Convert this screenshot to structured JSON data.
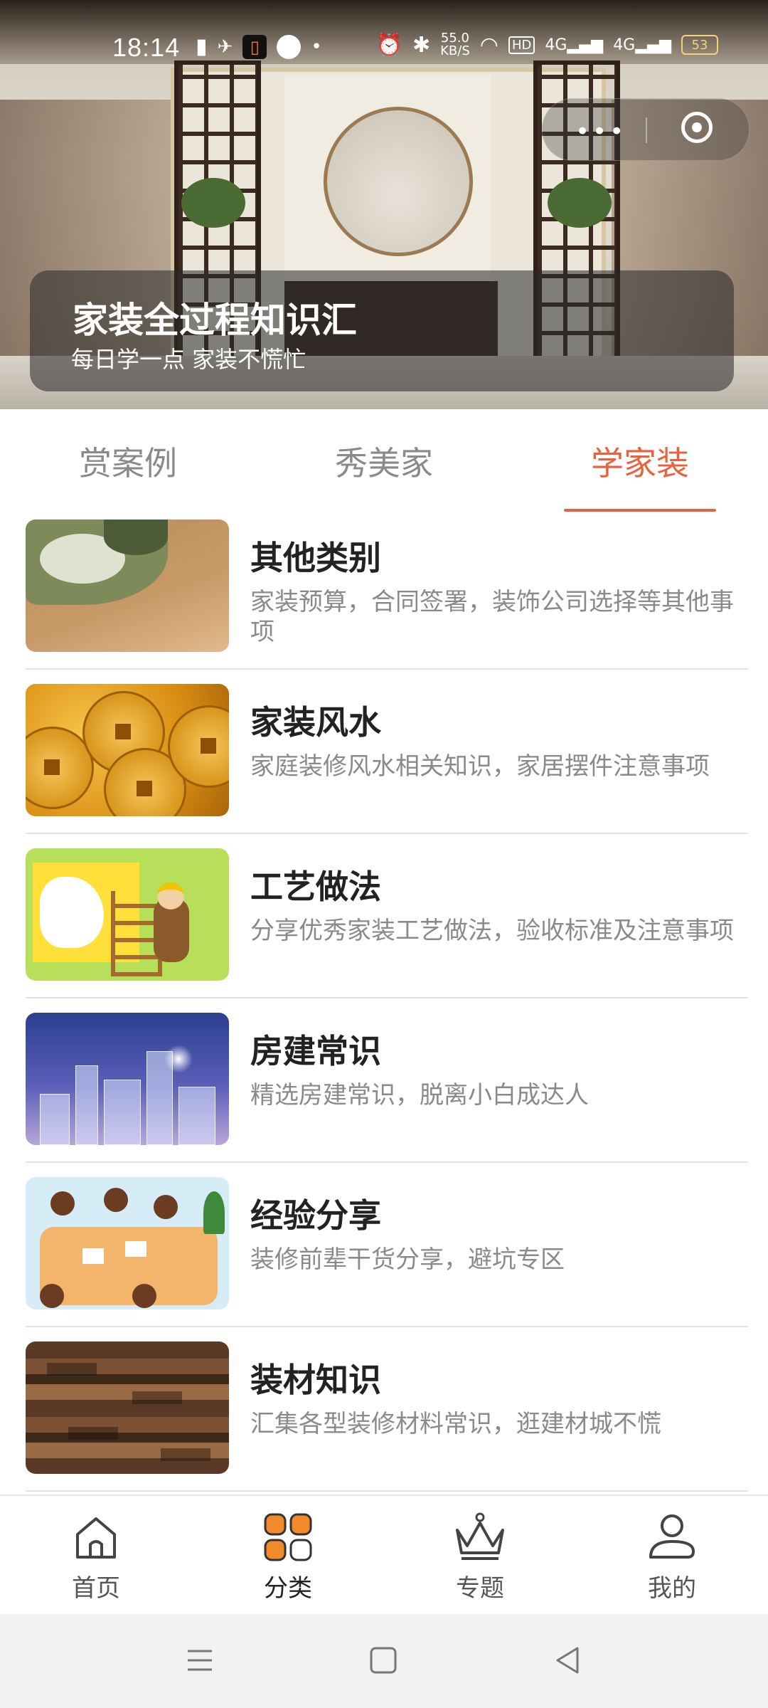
{
  "status_bar": {
    "time": "18:14",
    "network_speed": "55.0\nKB/S",
    "battery": "53",
    "icons": [
      "hd-icon",
      "notification-icon",
      "app-icon",
      "location-icon",
      "alarm-icon",
      "bluetooth-icon",
      "wifi-icon",
      "4g-signal-icon",
      "4g-signal-icon-2",
      "battery-icon"
    ]
  },
  "hero": {
    "title": "家装全过程知识汇",
    "subtitle": "每日学一点 家装不慌忙"
  },
  "tabs": [
    {
      "label": "赏案例",
      "active": false
    },
    {
      "label": "秀美家",
      "active": false
    },
    {
      "label": "学家装",
      "active": true
    }
  ],
  "accent_color": "#e9623e",
  "categories": [
    {
      "name": "其他类别",
      "desc": "家装预算，合同签署，装饰公司选择等其他事项"
    },
    {
      "name": "家装风水",
      "desc": "家庭装修风水相关知识，家居摆件注意事项"
    },
    {
      "name": "工艺做法",
      "desc": "分享优秀家装工艺做法，验收标准及注意事项"
    },
    {
      "name": "房建常识",
      "desc": "精选房建常识，脱离小白成达人"
    },
    {
      "name": "经验分享",
      "desc": "装修前辈干货分享，避坑专区"
    },
    {
      "name": "装材知识",
      "desc": "汇集各型装修材料常识，逛建材城不慌"
    }
  ],
  "bottom_nav": [
    {
      "label": "首页",
      "icon": "home-icon",
      "active": false
    },
    {
      "label": "分类",
      "icon": "category-icon",
      "active": true
    },
    {
      "label": "专题",
      "icon": "crown-icon",
      "active": false
    },
    {
      "label": "我的",
      "icon": "profile-icon",
      "active": false
    }
  ]
}
